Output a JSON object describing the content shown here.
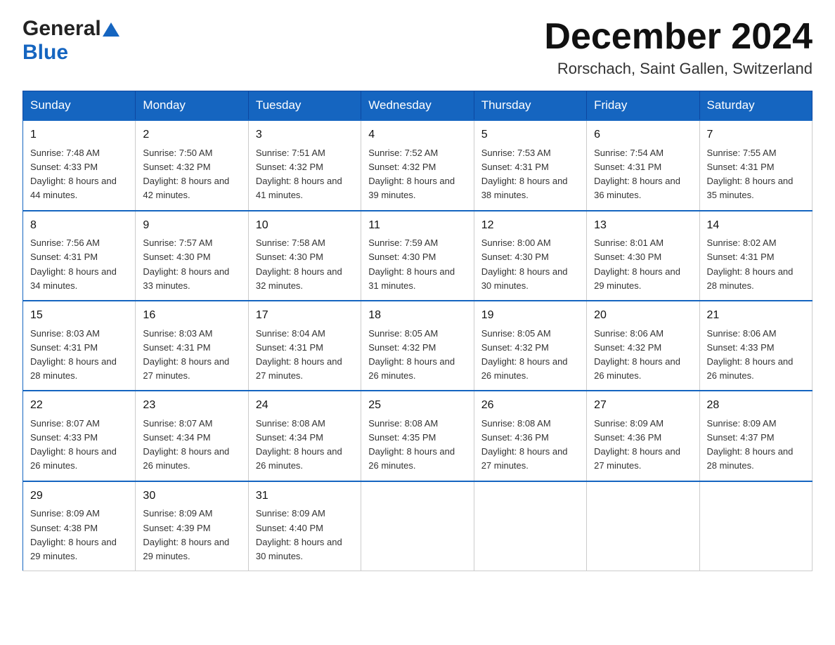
{
  "header": {
    "logo_general": "General",
    "logo_blue": "Blue",
    "month_title": "December 2024",
    "location": "Rorschach, Saint Gallen, Switzerland"
  },
  "weekdays": [
    "Sunday",
    "Monday",
    "Tuesday",
    "Wednesday",
    "Thursday",
    "Friday",
    "Saturday"
  ],
  "weeks": [
    [
      {
        "day": "1",
        "sunrise": "Sunrise: 7:48 AM",
        "sunset": "Sunset: 4:33 PM",
        "daylight": "Daylight: 8 hours and 44 minutes."
      },
      {
        "day": "2",
        "sunrise": "Sunrise: 7:50 AM",
        "sunset": "Sunset: 4:32 PM",
        "daylight": "Daylight: 8 hours and 42 minutes."
      },
      {
        "day": "3",
        "sunrise": "Sunrise: 7:51 AM",
        "sunset": "Sunset: 4:32 PM",
        "daylight": "Daylight: 8 hours and 41 minutes."
      },
      {
        "day": "4",
        "sunrise": "Sunrise: 7:52 AM",
        "sunset": "Sunset: 4:32 PM",
        "daylight": "Daylight: 8 hours and 39 minutes."
      },
      {
        "day": "5",
        "sunrise": "Sunrise: 7:53 AM",
        "sunset": "Sunset: 4:31 PM",
        "daylight": "Daylight: 8 hours and 38 minutes."
      },
      {
        "day": "6",
        "sunrise": "Sunrise: 7:54 AM",
        "sunset": "Sunset: 4:31 PM",
        "daylight": "Daylight: 8 hours and 36 minutes."
      },
      {
        "day": "7",
        "sunrise": "Sunrise: 7:55 AM",
        "sunset": "Sunset: 4:31 PM",
        "daylight": "Daylight: 8 hours and 35 minutes."
      }
    ],
    [
      {
        "day": "8",
        "sunrise": "Sunrise: 7:56 AM",
        "sunset": "Sunset: 4:31 PM",
        "daylight": "Daylight: 8 hours and 34 minutes."
      },
      {
        "day": "9",
        "sunrise": "Sunrise: 7:57 AM",
        "sunset": "Sunset: 4:30 PM",
        "daylight": "Daylight: 8 hours and 33 minutes."
      },
      {
        "day": "10",
        "sunrise": "Sunrise: 7:58 AM",
        "sunset": "Sunset: 4:30 PM",
        "daylight": "Daylight: 8 hours and 32 minutes."
      },
      {
        "day": "11",
        "sunrise": "Sunrise: 7:59 AM",
        "sunset": "Sunset: 4:30 PM",
        "daylight": "Daylight: 8 hours and 31 minutes."
      },
      {
        "day": "12",
        "sunrise": "Sunrise: 8:00 AM",
        "sunset": "Sunset: 4:30 PM",
        "daylight": "Daylight: 8 hours and 30 minutes."
      },
      {
        "day": "13",
        "sunrise": "Sunrise: 8:01 AM",
        "sunset": "Sunset: 4:30 PM",
        "daylight": "Daylight: 8 hours and 29 minutes."
      },
      {
        "day": "14",
        "sunrise": "Sunrise: 8:02 AM",
        "sunset": "Sunset: 4:31 PM",
        "daylight": "Daylight: 8 hours and 28 minutes."
      }
    ],
    [
      {
        "day": "15",
        "sunrise": "Sunrise: 8:03 AM",
        "sunset": "Sunset: 4:31 PM",
        "daylight": "Daylight: 8 hours and 28 minutes."
      },
      {
        "day": "16",
        "sunrise": "Sunrise: 8:03 AM",
        "sunset": "Sunset: 4:31 PM",
        "daylight": "Daylight: 8 hours and 27 minutes."
      },
      {
        "day": "17",
        "sunrise": "Sunrise: 8:04 AM",
        "sunset": "Sunset: 4:31 PM",
        "daylight": "Daylight: 8 hours and 27 minutes."
      },
      {
        "day": "18",
        "sunrise": "Sunrise: 8:05 AM",
        "sunset": "Sunset: 4:32 PM",
        "daylight": "Daylight: 8 hours and 26 minutes."
      },
      {
        "day": "19",
        "sunrise": "Sunrise: 8:05 AM",
        "sunset": "Sunset: 4:32 PM",
        "daylight": "Daylight: 8 hours and 26 minutes."
      },
      {
        "day": "20",
        "sunrise": "Sunrise: 8:06 AM",
        "sunset": "Sunset: 4:32 PM",
        "daylight": "Daylight: 8 hours and 26 minutes."
      },
      {
        "day": "21",
        "sunrise": "Sunrise: 8:06 AM",
        "sunset": "Sunset: 4:33 PM",
        "daylight": "Daylight: 8 hours and 26 minutes."
      }
    ],
    [
      {
        "day": "22",
        "sunrise": "Sunrise: 8:07 AM",
        "sunset": "Sunset: 4:33 PM",
        "daylight": "Daylight: 8 hours and 26 minutes."
      },
      {
        "day": "23",
        "sunrise": "Sunrise: 8:07 AM",
        "sunset": "Sunset: 4:34 PM",
        "daylight": "Daylight: 8 hours and 26 minutes."
      },
      {
        "day": "24",
        "sunrise": "Sunrise: 8:08 AM",
        "sunset": "Sunset: 4:34 PM",
        "daylight": "Daylight: 8 hours and 26 minutes."
      },
      {
        "day": "25",
        "sunrise": "Sunrise: 8:08 AM",
        "sunset": "Sunset: 4:35 PM",
        "daylight": "Daylight: 8 hours and 26 minutes."
      },
      {
        "day": "26",
        "sunrise": "Sunrise: 8:08 AM",
        "sunset": "Sunset: 4:36 PM",
        "daylight": "Daylight: 8 hours and 27 minutes."
      },
      {
        "day": "27",
        "sunrise": "Sunrise: 8:09 AM",
        "sunset": "Sunset: 4:36 PM",
        "daylight": "Daylight: 8 hours and 27 minutes."
      },
      {
        "day": "28",
        "sunrise": "Sunrise: 8:09 AM",
        "sunset": "Sunset: 4:37 PM",
        "daylight": "Daylight: 8 hours and 28 minutes."
      }
    ],
    [
      {
        "day": "29",
        "sunrise": "Sunrise: 8:09 AM",
        "sunset": "Sunset: 4:38 PM",
        "daylight": "Daylight: 8 hours and 29 minutes."
      },
      {
        "day": "30",
        "sunrise": "Sunrise: 8:09 AM",
        "sunset": "Sunset: 4:39 PM",
        "daylight": "Daylight: 8 hours and 29 minutes."
      },
      {
        "day": "31",
        "sunrise": "Sunrise: 8:09 AM",
        "sunset": "Sunset: 4:40 PM",
        "daylight": "Daylight: 8 hours and 30 minutes."
      },
      null,
      null,
      null,
      null
    ]
  ]
}
